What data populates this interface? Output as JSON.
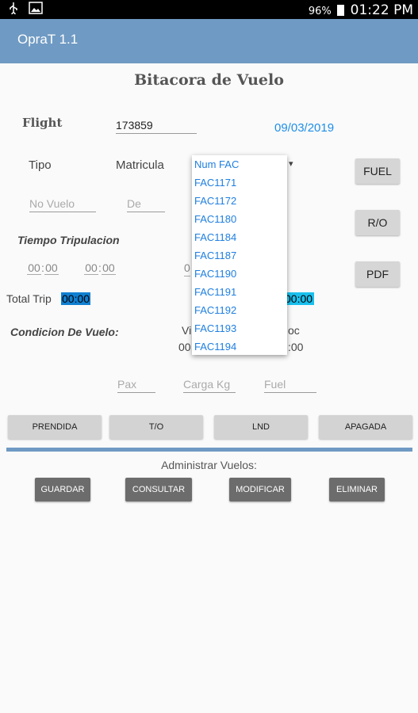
{
  "status_bar": {
    "battery": "96%",
    "time": "01:22 PM",
    "icons": [
      "usb-icon",
      "image-icon",
      "battery-icon"
    ]
  },
  "app_bar": {
    "title": "OpraT 1.1"
  },
  "page": {
    "title": "Bitacora de Vuelo"
  },
  "flight": {
    "label": "Flight",
    "value": "173859",
    "date": "09/03/2019"
  },
  "form": {
    "tipo_label": "Tipo",
    "matricula_label": "Matricula",
    "no_vuelo_placeholder": "No Vuelo",
    "de_placeholder": "De",
    "tiempo_tripulacion": "Tiempo Tripulacion",
    "time1_h": "00",
    "time1_m": "00",
    "time2_h": "00",
    "time2_m": "00",
    "total_trip_label": "Total Trip",
    "total_trip_value": "00:00",
    "right_total_value": "00:00",
    "condicion_label": "Condicion De Vuelo:",
    "cond_col1_fragment": "Vi",
    "cond_col1_value_fragment": "00",
    "cond_col2_fragment": "oc",
    "cond_col2_value_fragment": ":00",
    "pax_placeholder": "Pax",
    "carga_placeholder": "Carga Kg",
    "fuel_placeholder": "Fuel"
  },
  "side_buttons": {
    "fuel": "FUEL",
    "ro": "R/O",
    "pdf": "PDF"
  },
  "event_buttons": {
    "prendida": "PRENDIDA",
    "to": "T/O",
    "lnd": "LND",
    "apagada": "APAGADA"
  },
  "admin": {
    "label": "Administrar Vuelos:",
    "guardar": "GUARDAR",
    "consultar": "CONSULTAR",
    "modificar": "MODIFICAR",
    "eliminar": "ELIMINAR"
  },
  "dropdown": {
    "items": [
      "Num FAC",
      "FAC1171",
      "FAC1172",
      "FAC1180",
      "FAC1184",
      "FAC1187",
      "FAC1190",
      "FAC1191",
      "FAC1192",
      "FAC1193",
      "FAC1194"
    ]
  },
  "colors": {
    "app_bar": "#6f9ac3",
    "accent_blue": "#1f8ee8",
    "highlight": "#0f7fd1",
    "highlight_light": "#19c0ee"
  }
}
